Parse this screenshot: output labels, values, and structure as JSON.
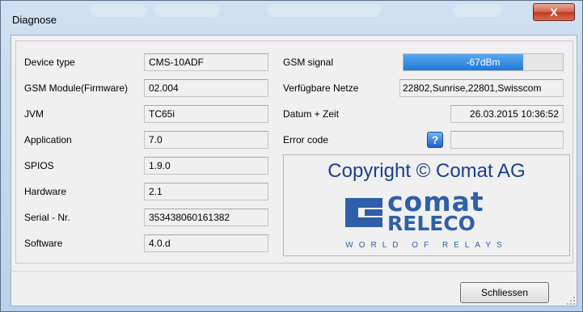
{
  "window": {
    "title": "Diagnose",
    "close_glyph": "X"
  },
  "left_fields": [
    {
      "label": "Device type",
      "value": "CMS-10ADF"
    },
    {
      "label": "GSM Module(Firmware)",
      "value": "02.004"
    },
    {
      "label": "JVM",
      "value": "TC65i"
    },
    {
      "label": "Application",
      "value": "7.0"
    },
    {
      "label": "SPIOS",
      "value": "1.9.0"
    },
    {
      "label": "Hardware",
      "value": "2.1"
    },
    {
      "label": "Serial - Nr.",
      "value": "353438060161382"
    },
    {
      "label": "Software",
      "value": "4.0.d"
    }
  ],
  "right_fields": {
    "gsm_signal": {
      "label": "GSM signal",
      "value_text": "-67dBm",
      "fill_fraction": 0.75,
      "fill_color": "#2a85e0"
    },
    "networks": {
      "label": "Verfügbare Netze",
      "value": "22802,Sunrise,22801,Swisscom"
    },
    "datetime": {
      "label": "Datum + Zeit",
      "value": "26.03.2015 10:36:52"
    },
    "error": {
      "label": "Error code",
      "value": "",
      "help_glyph": "?"
    }
  },
  "logo": {
    "copyright": "Copyright © Comat AG",
    "word1": "comat",
    "word2": "RELECO",
    "tagline": "WORLD OF RELAYS",
    "color": "#2f5fa8"
  },
  "footer": {
    "close_label": "Schliessen"
  }
}
